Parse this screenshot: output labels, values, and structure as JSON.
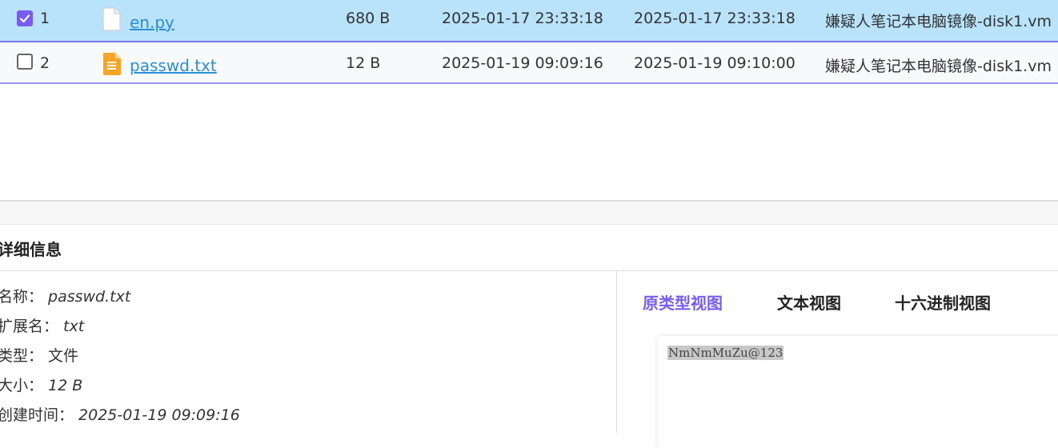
{
  "files": [
    {
      "index": "1",
      "name": "en.py",
      "size": "680 B",
      "created": "2025-01-17 23:33:18",
      "modified": "2025-01-17 23:33:18",
      "source": "嫌疑人笔记本电脑镜像-disk1.vm",
      "checked": true,
      "icon": "blank-file-icon"
    },
    {
      "index": "2",
      "name": "passwd.txt",
      "size": "12 B",
      "created": "2025-01-19 09:09:16",
      "modified": "2025-01-19 09:10:00",
      "source": "嫌疑人笔记本电脑镜像-disk1.vm",
      "checked": false,
      "icon": "text-file-icon"
    }
  ],
  "details": {
    "title": "详细信息",
    "props": [
      {
        "label": "名称：",
        "value": "passwd.txt"
      },
      {
        "label": "扩展名：",
        "value": "txt"
      },
      {
        "label": "类型：",
        "value": "文件"
      },
      {
        "label": "大小：",
        "value": "12 B"
      },
      {
        "label": "创建时间：",
        "value": "2025-01-19 09:09:16"
      }
    ],
    "tabs": [
      {
        "label": "原类型视图",
        "active": true
      },
      {
        "label": "文本视图",
        "active": false
      },
      {
        "label": "十六进制视图",
        "active": false
      }
    ],
    "preview_text": "NmNmMuZu@123"
  },
  "colors": {
    "selected_row": "#b9e3fb",
    "accent": "#7b5cf0",
    "link": "#2a8fd6",
    "txt_icon": "#f6a623"
  }
}
